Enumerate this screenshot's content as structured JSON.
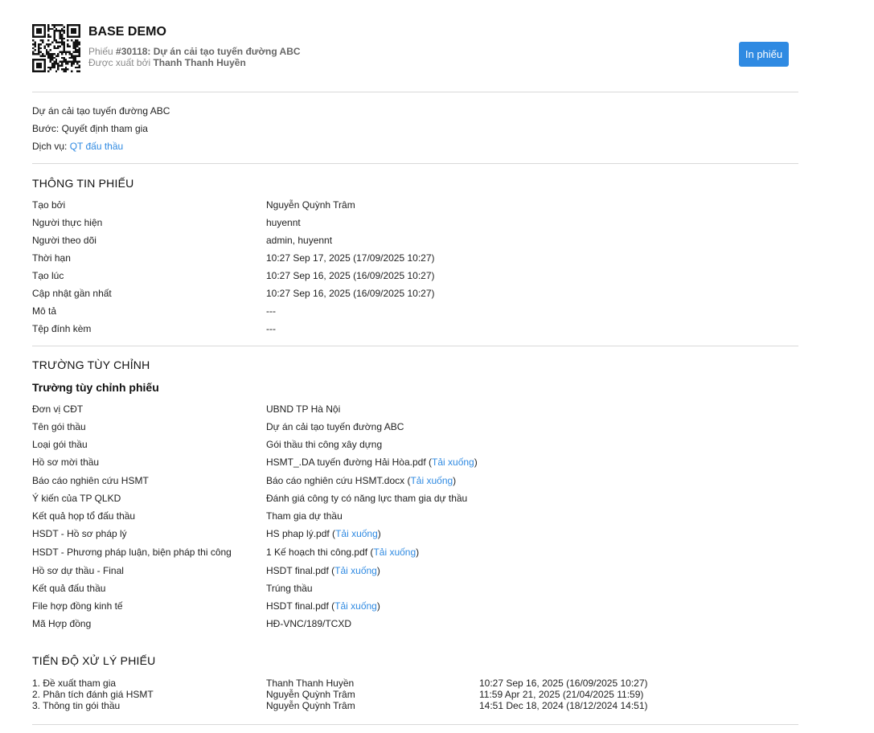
{
  "header": {
    "company": "BASE DEMO",
    "ticket_prefix": "Phiếu ",
    "ticket_code": "#30118: Dự án cải tạo tuyến đường ABC",
    "exported_prefix": "Được xuất bởi ",
    "exported_by": "Thanh Thanh Huyền",
    "print_label": "In phiếu"
  },
  "summary": {
    "project": "Dự án cải tạo tuyến đường ABC",
    "step_label": "Bước: ",
    "step_value": "Quyết định tham gia",
    "service_label": "Dịch vụ: ",
    "service_value": "QT đấu thầu"
  },
  "ticket_info": {
    "title": "THÔNG TIN PHIẾU",
    "rows": [
      {
        "label": "Tạo bởi",
        "value": "Nguyễn Quỳnh Trâm"
      },
      {
        "label": "Người thực hiện",
        "value": "huyennt"
      },
      {
        "label": "Người theo dõi",
        "value": "admin, huyennt"
      },
      {
        "label": "Thời hạn",
        "value": "10:27 Sep 17, 2025 (17/09/2025 10:27)"
      },
      {
        "label": "Tạo lúc",
        "value": "10:27 Sep 16, 2025 (16/09/2025 10:27)"
      },
      {
        "label": "Cập nhật gần nhất",
        "value": "10:27 Sep 16, 2025 (16/09/2025 10:27)"
      },
      {
        "label": "Mô tả",
        "value": "---"
      },
      {
        "label": "Tệp đính kèm",
        "value": "---"
      }
    ]
  },
  "custom_fields": {
    "title": "TRƯỜNG TÙY CHỈNH",
    "subtitle": "Trường tùy chỉnh phiếu",
    "download_label": "Tải xuống",
    "rows": [
      {
        "label": "Đơn vị CĐT",
        "value": "UBND TP Hà Nội"
      },
      {
        "label": "Tên gói thầu",
        "value": "Dự án cải tạo tuyến đường ABC"
      },
      {
        "label": "Loại gói thầu",
        "value": "Gói thầu thi công xây dựng"
      },
      {
        "label": "Hồ sơ mời thầu",
        "value": "HSMT_.DA tuyến đường Hải Hòa.pdf",
        "download": true
      },
      {
        "label": "Báo cáo nghiên cứu HSMT",
        "value": "Báo cáo nghiên cứu HSMT.docx",
        "download": true
      },
      {
        "label": "Ý kiến của TP QLKD",
        "value": "Đánh giá công ty có năng lực tham gia dự thầu"
      },
      {
        "label": "Kết quả họp tổ đấu thầu",
        "value": "Tham gia dự thầu"
      },
      {
        "label": "HSDT - Hồ sơ pháp lý",
        "value": "HS phap lý.pdf",
        "download": true
      },
      {
        "label": "HSDT - Phương pháp luận, biện pháp thi công",
        "value": "1 Kế hoạch thi công.pdf",
        "download": true
      },
      {
        "label": "Hồ sơ dự thầu - Final",
        "value": "HSDT final.pdf",
        "download": true
      },
      {
        "label": "Kết quả đấu thầu",
        "value": "Trúng thầu"
      },
      {
        "label": "File hợp đồng kinh tế",
        "value": "HSDT final.pdf",
        "download": true
      },
      {
        "label": "Mã Hợp đồng",
        "value": "HĐ-VNC/189/TCXD"
      }
    ]
  },
  "progress": {
    "title": "TIẾN ĐỘ XỬ LÝ PHIẾU",
    "rows": [
      {
        "step": "1. Đề xuất tham gia",
        "user": "Thanh Thanh Huyền",
        "time": "10:27 Sep 16, 2025 (16/09/2025 10:27)"
      },
      {
        "step": "2. Phân tích đánh giá HSMT",
        "user": "Nguyễn Quỳnh Trâm",
        "time": "11:59 Apr 21, 2025 (21/04/2025 11:59)"
      },
      {
        "step": "3. Thông tin gói thầu",
        "user": "Nguyễn Quỳnh Trâm",
        "time": "14:51 Dec 18, 2024 (18/12/2024 14:51)"
      }
    ]
  }
}
